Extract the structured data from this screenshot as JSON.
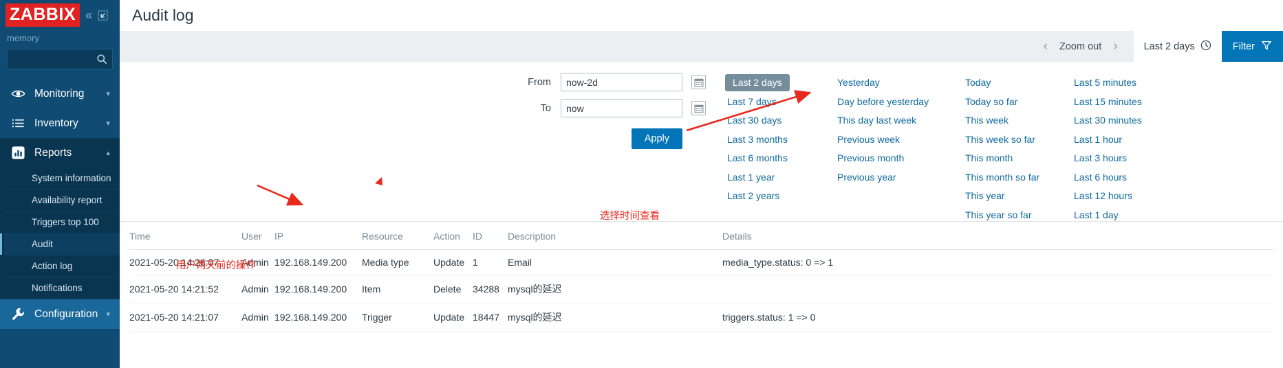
{
  "sidebar": {
    "logo": "ZABBIX",
    "collapse_icon": "chevrons-left-icon",
    "compact_icon": "collapse-view-icon",
    "user": "memory",
    "search": {
      "value": "",
      "placeholder": "",
      "icon": "search-icon"
    },
    "nav": [
      {
        "label": "Monitoring",
        "icon": "eye-icon",
        "chevron": "chevron-down-icon"
      },
      {
        "label": "Inventory",
        "icon": "list-icon",
        "chevron": "chevron-down-icon"
      },
      {
        "label": "Reports",
        "icon": "bar-chart-icon",
        "chevron": "chevron-up-icon"
      },
      {
        "label": "Configuration",
        "icon": "wrench-icon",
        "chevron": "chevron-down-icon"
      }
    ],
    "sub_items": [
      "System information",
      "Availability report",
      "Triggers top 100",
      "Audit",
      "Action log",
      "Notifications"
    ],
    "active_sub": "Audit"
  },
  "header": {
    "title": "Audit log"
  },
  "timebar": {
    "prev_icon": "chevron-left-icon",
    "zoom_out": "Zoom out",
    "next_icon": "chevron-right-icon",
    "range_tab": "Last 2 days",
    "clock_icon": "clock-icon",
    "filter": "Filter",
    "filter_icon": "funnel-icon"
  },
  "filter": {
    "from_label": "From",
    "from_value": "now-2d",
    "to_label": "To",
    "to_value": "now",
    "calendar_icon": "calendar-icon",
    "apply": "Apply",
    "columns": [
      [
        "Last 2 days",
        "Last 7 days",
        "Last 30 days",
        "Last 3 months",
        "Last 6 months",
        "Last 1 year",
        "Last 2 years"
      ],
      [
        "Yesterday",
        "Day before yesterday",
        "This day last week",
        "Previous week",
        "Previous month",
        "Previous year"
      ],
      [
        "Today",
        "Today so far",
        "This week",
        "This week so far",
        "This month",
        "This month so far",
        "This year",
        "This year so far"
      ],
      [
        "Last 5 minutes",
        "Last 15 minutes",
        "Last 30 minutes",
        "Last 1 hour",
        "Last 3 hours",
        "Last 6 hours",
        "Last 12 hours",
        "Last 1 day"
      ]
    ],
    "selected": "Last 2 days"
  },
  "annotations": [
    {
      "text": "选择时间查看"
    },
    {
      "text": "用户两天前的操作"
    }
  ],
  "table": {
    "headers": [
      "Time",
      "User",
      "IP",
      "Resource",
      "Action",
      "ID",
      "Description",
      "Details"
    ],
    "rows": [
      {
        "time": "2021-05-20 14:26:07",
        "user": "Admin",
        "ip": "192.168.149.200",
        "resource": "Media type",
        "action": "Update",
        "id": "1",
        "description": "Email",
        "details": "media_type.status: 0 => 1"
      },
      {
        "time": "2021-05-20 14:21:52",
        "user": "Admin",
        "ip": "192.168.149.200",
        "resource": "Item",
        "action": "Delete",
        "id": "34288",
        "description": "mysql的延迟",
        "details": ""
      },
      {
        "time": "2021-05-20 14:21:07",
        "user": "Admin",
        "ip": "192.168.149.200",
        "resource": "Trigger",
        "action": "Update",
        "id": "18447",
        "description": "mysql的延迟",
        "details": "triggers.status: 1 => 0"
      }
    ]
  },
  "colors": {
    "brand_red": "#e02222",
    "sidebar_bg": "#0f4b73",
    "accent_blue": "#0275b8",
    "link_blue": "#0f6a9e",
    "annotation_red": "#e8291e",
    "selected_gray": "#768d9c"
  }
}
